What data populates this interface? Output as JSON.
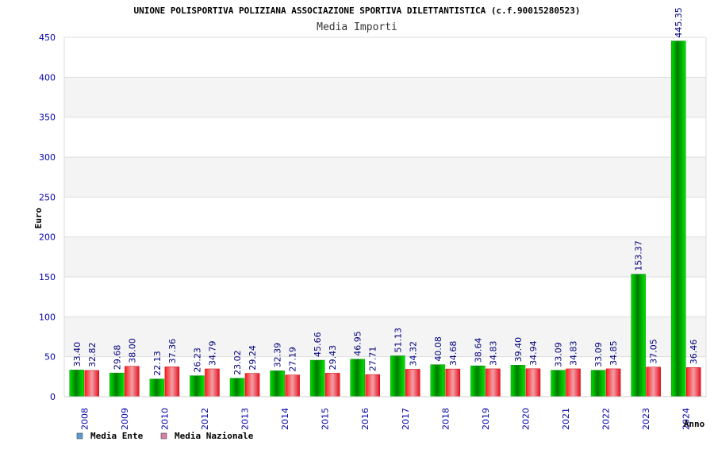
{
  "chart_data": {
    "type": "bar",
    "title": "UNIONE POLISPORTIVA POLIZIANA ASSOCIAZIONE SPORTIVA DILETTANTISTICA (c.f.90015280523)",
    "subtitle": "Media Importi",
    "xlabel": "Anno",
    "ylabel": "Euro",
    "ylim": [
      0,
      450
    ],
    "yticks": [
      0,
      50,
      100,
      150,
      200,
      250,
      300,
      350,
      400,
      450
    ],
    "grid": true,
    "legend_position": "bottom-left",
    "categories": [
      "2008",
      "2009",
      "2010",
      "2012",
      "2013",
      "2014",
      "2015",
      "2016",
      "2017",
      "2018",
      "2019",
      "2020",
      "2021",
      "2022",
      "2023",
      "2024"
    ],
    "series": [
      {
        "name": "Media Ente",
        "color": "#00b400",
        "legend_color": "#5b9bd5",
        "values": [
          33.4,
          29.68,
          22.13,
          26.23,
          23.02,
          32.39,
          45.66,
          46.95,
          51.13,
          40.08,
          38.64,
          39.4,
          33.09,
          33.09,
          153.37,
          445.35
        ],
        "labels": [
          "33.40",
          "29.68",
          "22.13",
          "26.23",
          "23.02",
          "32.39",
          "45.66",
          "46.95",
          "51.13",
          "40.08",
          "38.64",
          "39.40",
          "33.09",
          "33.09",
          "153.37",
          "445.35"
        ]
      },
      {
        "name": "Media Nazionale",
        "color": "#e8202a",
        "legend_color": "#d87fa8",
        "values": [
          32.82,
          38.0,
          37.36,
          34.79,
          29.24,
          27.19,
          29.43,
          27.71,
          34.32,
          34.68,
          34.83,
          34.94,
          34.83,
          34.85,
          37.05,
          36.46
        ],
        "labels": [
          "32.82",
          "38.00",
          "37.36",
          "34.79",
          "29.24",
          "27.19",
          "29.43",
          "27.71",
          "34.32",
          "34.68",
          "34.83",
          "34.94",
          "34.83",
          "34.85",
          "37.05",
          "36.46"
        ]
      }
    ]
  }
}
